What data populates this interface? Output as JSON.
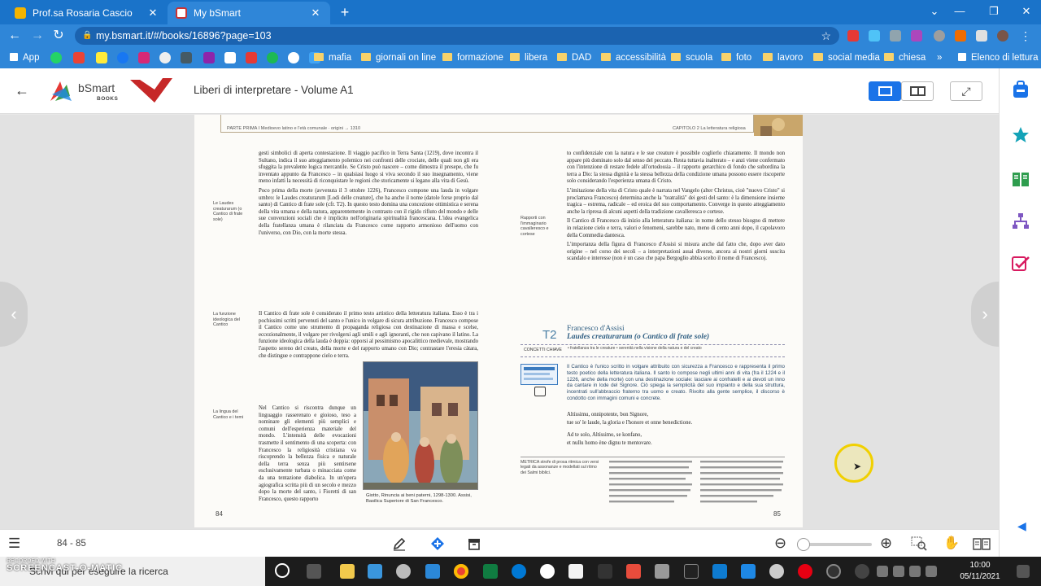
{
  "tabs": [
    {
      "title": "Prof.sa Rosaria Cascio",
      "close": "✕",
      "active": false
    },
    {
      "title": "My bSmart",
      "close": "✕",
      "active": true
    }
  ],
  "new_tab": "+",
  "window_controls": {
    "minimize": "—",
    "restore": "❐",
    "close": "✕",
    "menu": "⌄"
  },
  "address": {
    "url": "my.bsmart.it/#/books/16896?page=103"
  },
  "nav": {
    "back": "←",
    "forward": "→",
    "reload": "↻"
  },
  "bookmarks": {
    "apps": "App",
    "folders": [
      "mafia",
      "giornali on line",
      "formazione",
      "libera",
      "DAD",
      "accessibilità",
      "scuola",
      "foto",
      "lavoro",
      "social media",
      "chiesa"
    ],
    "more": "»",
    "reading_list": "Elenco di lettura"
  },
  "reader": {
    "back": "←",
    "brand": "bSmart",
    "brand_sub": "BOOKS",
    "book_title": "Liberi di interpretare - Volume A1",
    "fullscreen": "⤢"
  },
  "pages": {
    "left": {
      "running_head": "PARTE PRIMA  I Medioevo latino e l'età comunale · origini → 1310",
      "folio": "84",
      "notes": [
        "Le Laudes creaturarum (o Cantico di frate sole)",
        "La funzione ideologica del Cantico",
        "La lingua del Cantico e i temi"
      ],
      "para1": "gesti simbolici di aperta contestazione. Il viaggio pacifico in Terra Santa (1219), dove incontra il Sultano, indica il suo atteggiamento polemico nei confronti delle crociate, delle quali non gli era sfuggita la prevalente logica mercantile. Se Cristo può nascere – come dimostra il presepe, che fu inventato appunto da Francesco – in qualsiasi luogo si viva secondo il suo insegnamento, viene meno infatti la necessità di riconquistare le regioni che storicamente si legano alla vita di Gesù.",
      "para2": "Poco prima della morte (avvenuta il 3 ottobre 1226), Francesco compone una lauda in volgare umbro: le Laudes creaturarum [Lodi delle creature], che ha anche il nome (datole forse proprio dal santo) di Cantico di frate sole (cfr. T2). In questo testo domina una concezione ottimistica e serena della vita umana e della natura, apparentemente in contrasto con il rigido rifiuto del mondo e delle sue convenzioni sociali che è implicito nell'originaria spiritualità francescana. L'idea evangelica della fratellanza umana è rilanciata da Francesco come rapporto armonioso dell'uomo con l'universo, con Dio, con la morte stessa.",
      "para3": "Il Cantico di frate sole è considerato il primo testo artistico della letteratura italiana. Esso è tra i pochissimi scritti pervenuti del santo e l'unico in volgare di sicura attribuzione. Francesco compose il Cantico come uno strumento di propaganda religiosa con destinazione di massa e scelse, eccezionalmente, il volgare per rivolgersi agli umili e agli ignoranti, che non capivano il latino. La funzione ideologica della lauda è doppia: opporsi al pessimismo apocalittico medievale, mostrando l'aspetto sereno del creato, della morte e del rapporto umano con Dio; contrastare l'eresia càtara, che distingue e contrappone cielo e terra.",
      "para4": "Nel Cantico si riscontra dunque un linguaggio rasserenato e gioioso, teso a nominare gli elementi più semplici e comuni dell'esperienza materiale del mondo. L'intensità delle evocazioni trasmette il sentimento di una scoperta: con Francesco la religiosità cristiana va riscoprendo la bellezza fisica e naturale della terra senza più sentirsene esclusivamente turbata o minacciata come da una tentazione diabolica. In un'opera agiografica scritta più di un secolo e mezzo dopo la morte del santo, i Fioretti di san Francesco, questo rapporto",
      "caption": "Giotto, Rinuncia ai beni paterni, 1298-1300. Assisi, Basilica Superiore di San Francesco."
    },
    "right": {
      "running_head": "CAPITOLO 2  La letteratura religiosa",
      "folio": "85",
      "notes": [
        "Rapporti con l'immaginario cavalleresco e cortese"
      ],
      "para1": "to confidenziale con la natura e le sue creature è possibile coglierlo chiaramente. Il mondo non appare più dominato solo dal senso del peccato. Resta tuttavia inalterato – e anzi viene confermato con l'intenzione di restare fedele all'ortodossia – il rapporto gerarchico di fondo che subordina la terra a Dio: la stessa dignità e la stessa bellezza della condizione umana possono essere riscoperte solo considerando l'esperienza umana di Cristo.",
      "para2": "L'imitazione della vita di Cristo quale è narrata nel Vangelo (alter Christus, cioè \"nuovo Cristo\" si proclamava Francesco) determina anche la \"teatralità\" dei gesti del santo: è la dimensione insieme tragica – estrema, radicale – ed eroica del suo comportamento. Converge in questo atteggiamento anche la ripresa di alcuni aspetti della tradizione cavalleresca e cortese.",
      "para3": "Il Cantico di Francesco dà inizio alla letteratura italiana: in nome dello stesso bisogno di mettere in relazione cielo e terra, valori e fenomeni, sarebbe nato, meno di cento anni dopo, il capolavoro della Commedia dantesca.",
      "para4": "L'importanza della figura di Francesco d'Assisi si misura anche dal fatto che, dopo aver dato origine – nel corso dei secoli – a interpretazioni assai diverse, ancora ai nostri giorni suscita scandalo e interesse (non è un caso che papa Bergoglio abbia scelto il nome di Francesco).",
      "t2_number": "T2",
      "t2_author": "Francesco d'Assisi",
      "t2_title": "Laudes creaturarum (o Cantico di frate sole)",
      "concetti": "CONCETTI CHIAVE",
      "concetti_text": "• fratellanza tra le creature • serenità nella visione della natura e del creato",
      "intro": "Il Cantico è l'unico scritto in volgare attribuito con sicurezza a Francesco e rappresenta il primo testo poetico della letteratura italiana. Il santo lo compose negli ultimi anni di vita (fra il 1224 e il 1226, anche della morte) con una destinazione sociale: lasciare ai confratelli e ai devoti un inno da cantare in lode del Signore. Ciò spiega la semplicità del suo impianto e della sua struttura, incentrati sull'abbraccio fraterno tra uomo e creato. Rivolto alla gente semplice, il discorso è condotto con immagini comuni e concrete.",
      "verse1": "Altíssimu, onnipotente, bon Signore,",
      "verse2": "tue so' le laude, la gloria e l'honore et onne benedictione.",
      "verse3": "Ad te solo, Altíssimo, se konfano,",
      "verse4": "et nullu homo ène dignu te mentovare.",
      "metrica": "METRICA  strofe di prosa ritmica con versi legati da assonanze e modellati sul ritmo dei Salmi biblici."
    }
  },
  "bottom": {
    "menu": "☰",
    "page_indicator": "84 - 85",
    "zoom_minus": "−",
    "zoom_plus": "+",
    "zoom_level": 0.05
  },
  "taskbar": {
    "search_placeholder": "Scrivi qui per eseguire la ricerca",
    "watermark_top": "RECORDED WITH",
    "watermark_brand": "SCREENCAST-O-MATIC",
    "time": "10:00",
    "date": "05/11/2021"
  },
  "colors": {
    "chrome_blue": "#2f86d8",
    "bsmart_blue": "#1a73e8",
    "rail_teal": "#14a3b8"
  }
}
